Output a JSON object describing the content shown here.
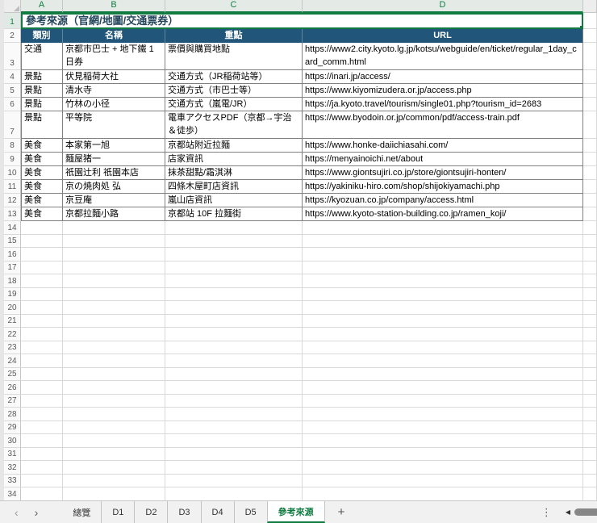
{
  "colors": {
    "accent_green": "#107C41",
    "header_fill": "#215579",
    "header_text": "#FFFFFF",
    "title_text": "#24465C",
    "table_border": "#808080",
    "gridline": "#D9D9D9"
  },
  "grid": {
    "column_letters": [
      "A",
      "B",
      "C",
      "D"
    ],
    "empty_row_numbers": [
      "14",
      "15",
      "16",
      "17",
      "18",
      "19",
      "20",
      "21",
      "22",
      "23",
      "24",
      "25",
      "26",
      "27",
      "28",
      "29",
      "30",
      "31",
      "32",
      "33",
      "34"
    ]
  },
  "title_row": {
    "num": "1",
    "text": "參考來源（官網/地圖/交通票券）"
  },
  "header": {
    "num": "2",
    "cells": [
      "類別",
      "名稱",
      "重點",
      "URL"
    ]
  },
  "table": {
    "rows": [
      {
        "num": "3",
        "tall": true,
        "category": "交通",
        "name": "京都市巴士 + 地下鐵 1 日券",
        "focus": "票價與購買地點",
        "url": "https://www2.city.kyoto.lg.jp/kotsu/webguide/en/ticket/regular_1day_card_comm.html"
      },
      {
        "num": "4",
        "tall": false,
        "category": "景點",
        "name": "伏見稲荷大社",
        "focus": "交通方式（JR稲荷站等）",
        "url": "https://inari.jp/access/"
      },
      {
        "num": "5",
        "tall": false,
        "category": "景點",
        "name": "清水寺",
        "focus": "交通方式（市巴士等）",
        "url": "https://www.kiyomizudera.or.jp/access.php"
      },
      {
        "num": "6",
        "tall": false,
        "category": "景點",
        "name": "竹林の小径",
        "focus": "交通方式（嵐電/JR）",
        "url": "https://ja.kyoto.travel/tourism/single01.php?tourism_id=2683"
      },
      {
        "num": "7",
        "tall": true,
        "category": "景點",
        "name": "平等院",
        "focus": "電車アクセスPDF（京都→宇治＆徒歩）",
        "url": "https://www.byodoin.or.jp/common/pdf/access-train.pdf"
      },
      {
        "num": "8",
        "tall": false,
        "category": "美食",
        "name": "本家第一旭",
        "focus": "京都站附近拉麵",
        "url": "https://www.honke-daiichiasahi.com/"
      },
      {
        "num": "9",
        "tall": false,
        "category": "美食",
        "name": "麵屋猪一",
        "focus": "店家資訊",
        "url": "https://menyainoichi.net/about"
      },
      {
        "num": "10",
        "tall": false,
        "category": "美食",
        "name": "祇園辻利 祇園本店",
        "focus": "抹茶甜點/霜淇淋",
        "url": "https://www.giontsujiri.co.jp/store/giontsujiri-honten/"
      },
      {
        "num": "11",
        "tall": false,
        "category": "美食",
        "name": "京の焼肉処 弘",
        "focus": "四條木屋町店資訊",
        "url": "https://yakiniku-hiro.com/shop/shijokiyamachi.php"
      },
      {
        "num": "12",
        "tall": false,
        "category": "美食",
        "name": "京豆庵",
        "focus": "嵐山店資訊",
        "url": "https://kyozuan.co.jp/company/access.html"
      },
      {
        "num": "13",
        "tall": false,
        "category": "美食",
        "name": "京都拉麵小路",
        "focus": "京都站 10F 拉麵街",
        "url": "https://www.kyoto-station-building.co.jp/ramen_koji/"
      }
    ]
  },
  "sheet_tabs": {
    "nav_left": "‹",
    "nav_right": "›",
    "inactive": [
      "總覽",
      "D1",
      "D2",
      "D3",
      "D4",
      "D5"
    ],
    "active": "參考來源",
    "add_label": "+",
    "more_icon": "⋮",
    "scroll_left_icon": "◀"
  }
}
